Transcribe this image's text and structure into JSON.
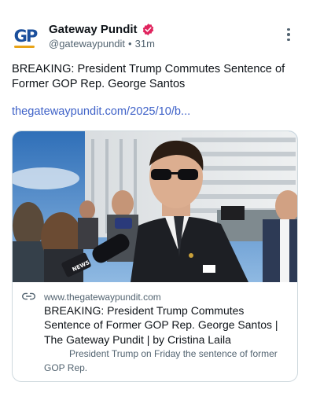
{
  "author": {
    "name": "Gateway Pundit",
    "handle": "@gatewaypundit",
    "separator": "•",
    "time": "31m",
    "avatar_text": "GP"
  },
  "post": {
    "text": "BREAKING: President Trump Commutes Sentence of Former GOP Rep. George Santos",
    "link": "thegatewaypundit.com/2025/10/b..."
  },
  "card": {
    "image_alt": "George Santos speaking to reporters outside a courthouse",
    "mic_flag": "NEWS",
    "domain": "www.thegatewaypundit.com",
    "title": "BREAKING: President Trump Commutes Sentence of Former GOP Rep. George Santos | The Gateway Pundit | by Cristina Laila",
    "description": "President Trump on Friday the sentence of former GOP Rep."
  },
  "icons": {
    "verified": "verified-badge-icon",
    "more": "more-vertical-icon",
    "link": "link-icon"
  },
  "colors": {
    "link": "#3f62c8",
    "verified": "#e0245e",
    "secondary_text": "#536471",
    "logo_blue": "#1b4f9c",
    "logo_accent": "#e8a317"
  }
}
